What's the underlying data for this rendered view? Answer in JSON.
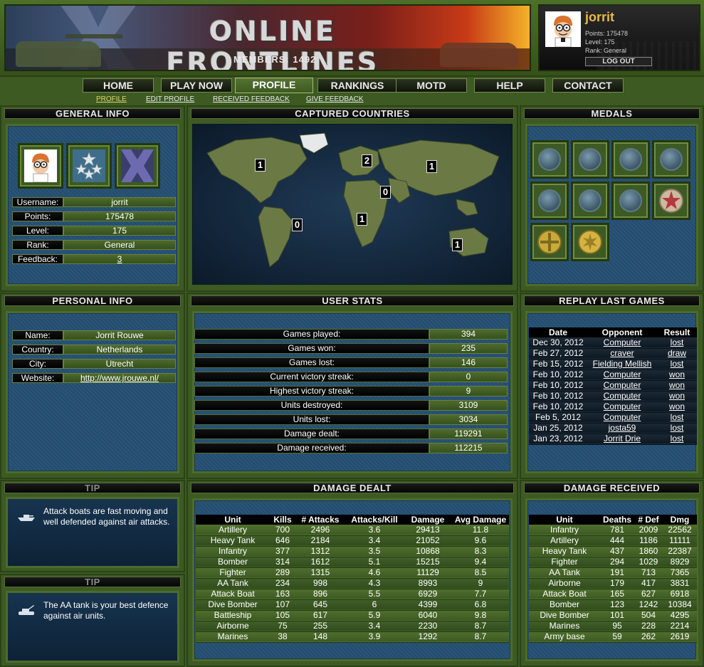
{
  "header": {
    "site_title": "ONLINE FRONTLINES",
    "members_label": "MEMBERS: 1492",
    "user": {
      "name": "jorrit",
      "points": "Points: 175478",
      "level": "Level: 175",
      "rank": "Rank: General",
      "logout": "LOG OUT"
    }
  },
  "nav": {
    "items": [
      "HOME",
      "PLAY NOW",
      "PROFILE",
      "RANKINGS",
      "MOTD",
      "HELP",
      "CONTACT"
    ],
    "active": "PROFILE"
  },
  "subnav": {
    "items": [
      "PROFILE",
      "EDIT PROFILE",
      "RECEIVED FEEDBACK",
      "GIVE FEEDBACK"
    ],
    "active": "PROFILE"
  },
  "general_info": {
    "title": "GENERAL INFO",
    "rows": [
      {
        "label": "Username:",
        "value": "jorrit"
      },
      {
        "label": "Points:",
        "value": "175478"
      },
      {
        "label": "Level:",
        "value": "175"
      },
      {
        "label": "Rank:",
        "value": "General"
      },
      {
        "label": "Feedback:",
        "value": "3"
      }
    ]
  },
  "captured_countries": {
    "title": "CAPTURED COUNTRIES",
    "markers": [
      {
        "region": "north-america",
        "value": "1"
      },
      {
        "region": "europe",
        "value": "2"
      },
      {
        "region": "asia",
        "value": "1"
      },
      {
        "region": "middle-east",
        "value": "0"
      },
      {
        "region": "south-america",
        "value": "0"
      },
      {
        "region": "africa",
        "value": "1"
      },
      {
        "region": "australia",
        "value": "1"
      }
    ]
  },
  "medals": {
    "title": "MEDALS",
    "slots": [
      "empty",
      "empty",
      "empty",
      "empty",
      "empty",
      "empty",
      "empty",
      "star-medal",
      "cross-medal",
      "sun-medal"
    ]
  },
  "personal_info": {
    "title": "PERSONAL INFO",
    "rows": [
      {
        "label": "Name:",
        "value": "Jorrit Rouwe"
      },
      {
        "label": "Country:",
        "value": "Netherlands"
      },
      {
        "label": "City:",
        "value": "Utrecht"
      },
      {
        "label": "Website:",
        "value": "http://www.jrouwe.nl/"
      }
    ]
  },
  "user_stats": {
    "title": "USER STATS",
    "rows": [
      {
        "label": "Games played:",
        "value": "394"
      },
      {
        "label": "Games won:",
        "value": "235"
      },
      {
        "label": "Games lost:",
        "value": "146"
      },
      {
        "label": "Current victory streak:",
        "value": "0"
      },
      {
        "label": "Highest victory streak:",
        "value": "9"
      },
      {
        "label": "Units destroyed:",
        "value": "3109"
      },
      {
        "label": "Units lost:",
        "value": "3034"
      },
      {
        "label": "Damage dealt:",
        "value": "119291"
      },
      {
        "label": "Damage received:",
        "value": "112215"
      }
    ]
  },
  "replay": {
    "title": "REPLAY LAST GAMES",
    "columns": [
      "Date",
      "Opponent",
      "Result"
    ],
    "rows": [
      [
        "Dec 30, 2012",
        "Computer",
        "lost"
      ],
      [
        "Feb 27, 2012",
        "craver",
        "draw"
      ],
      [
        "Feb 15, 2012",
        "Fielding Mellish",
        "lost"
      ],
      [
        "Feb 10, 2012",
        "Computer",
        "won"
      ],
      [
        "Feb 10, 2012",
        "Computer",
        "won"
      ],
      [
        "Feb 10, 2012",
        "Computer",
        "won"
      ],
      [
        "Feb 10, 2012",
        "Computer",
        "won"
      ],
      [
        "Feb 5, 2012",
        "Computer",
        "lost"
      ],
      [
        "Jan 25, 2012",
        "josta59",
        "lost"
      ],
      [
        "Jan 23, 2012",
        "Jorrit Drie",
        "lost"
      ]
    ]
  },
  "tips": [
    {
      "title": "TIP",
      "icon": "attack-boat-icon",
      "text": "Attack boats are fast moving and well defended against air attacks."
    },
    {
      "title": "TIP",
      "icon": "aa-tank-icon",
      "text": "The AA tank is your best defence against air units."
    }
  ],
  "damage_dealt": {
    "title": "DAMAGE DEALT",
    "columns": [
      "Unit",
      "Kills",
      "# Attacks",
      "Attacks/Kill",
      "Damage",
      "Avg Damage"
    ],
    "rows": [
      [
        "Artillery",
        "700",
        "2496",
        "3.6",
        "29413",
        "11.8"
      ],
      [
        "Heavy Tank",
        "646",
        "2184",
        "3.4",
        "21052",
        "9.6"
      ],
      [
        "Infantry",
        "377",
        "1312",
        "3.5",
        "10868",
        "8.3"
      ],
      [
        "Bomber",
        "314",
        "1612",
        "5.1",
        "15215",
        "9.4"
      ],
      [
        "Fighter",
        "289",
        "1315",
        "4.6",
        "11129",
        "8.5"
      ],
      [
        "AA Tank",
        "234",
        "998",
        "4.3",
        "8993",
        "9"
      ],
      [
        "Attack Boat",
        "163",
        "896",
        "5.5",
        "6929",
        "7.7"
      ],
      [
        "Dive Bomber",
        "107",
        "645",
        "6",
        "4399",
        "6.8"
      ],
      [
        "Battleship",
        "105",
        "617",
        "5.9",
        "6040",
        "9.8"
      ],
      [
        "Airborne",
        "75",
        "255",
        "3.4",
        "2230",
        "8.7"
      ],
      [
        "Marines",
        "38",
        "148",
        "3.9",
        "1292",
        "8.7"
      ]
    ]
  },
  "damage_received": {
    "title": "DAMAGE RECEIVED",
    "columns": [
      "Unit",
      "Deaths",
      "# Def",
      "Dmg"
    ],
    "rows": [
      [
        "Infantry",
        "781",
        "2009",
        "22562"
      ],
      [
        "Artillery",
        "444",
        "1186",
        "11111"
      ],
      [
        "Heavy Tank",
        "437",
        "1860",
        "22387"
      ],
      [
        "Fighter",
        "294",
        "1029",
        "8929"
      ],
      [
        "AA Tank",
        "191",
        "713",
        "7365"
      ],
      [
        "Airborne",
        "179",
        "417",
        "3831"
      ],
      [
        "Attack Boat",
        "165",
        "627",
        "6918"
      ],
      [
        "Bomber",
        "123",
        "1242",
        "10384"
      ],
      [
        "Dive Bomber",
        "101",
        "504",
        "4295"
      ],
      [
        "Marines",
        "95",
        "228",
        "2214"
      ],
      [
        "Army base",
        "59",
        "262",
        "2619"
      ]
    ]
  }
}
